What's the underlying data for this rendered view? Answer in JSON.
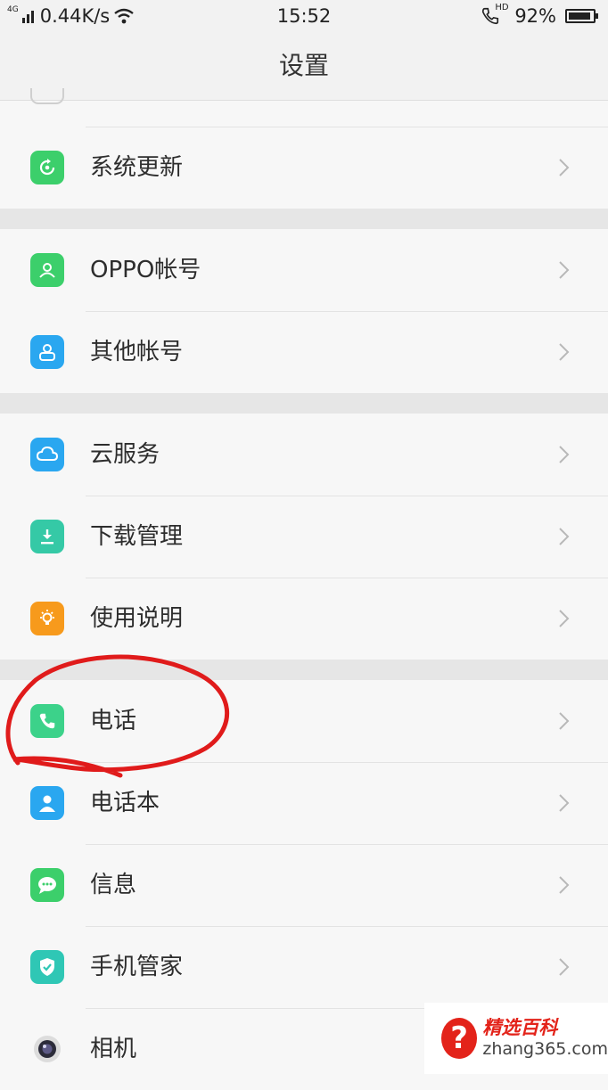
{
  "status_bar": {
    "network": "4G",
    "speed": "0.44K/s",
    "time": "15:52",
    "call_icon_label": "HD",
    "battery": "92%",
    "battery_level": 0.92
  },
  "header": {
    "title": "设置"
  },
  "groups": [
    {
      "items": [
        {
          "label": "系统更新",
          "icon": "system-update-icon",
          "color": "#3ccf6b"
        }
      ]
    },
    {
      "items": [
        {
          "label": "OPPO帐号",
          "icon": "oppo-account-icon",
          "color": "#3ccf6b"
        },
        {
          "label": "其他帐号",
          "icon": "other-account-icon",
          "color": "#2aa7f0"
        }
      ]
    },
    {
      "items": [
        {
          "label": "云服务",
          "icon": "cloud-icon",
          "color": "#2aa7f0"
        },
        {
          "label": "下载管理",
          "icon": "download-icon",
          "color": "#35c9a6"
        },
        {
          "label": "使用说明",
          "icon": "bulb-icon",
          "color": "#f79a1c"
        }
      ]
    },
    {
      "items": [
        {
          "label": "电话",
          "icon": "phone-icon",
          "color": "#3cd28a"
        },
        {
          "label": "电话本",
          "icon": "contacts-icon",
          "color": "#2aa7f0"
        },
        {
          "label": "信息",
          "icon": "message-icon",
          "color": "#3ccf6b"
        },
        {
          "label": "手机管家",
          "icon": "phone-manager-icon",
          "color": "#2fc7b5"
        },
        {
          "label": "相机",
          "icon": "camera-icon",
          "color": "#8a8a8a"
        }
      ]
    }
  ],
  "annotation_color": "#e01b1b",
  "watermark": {
    "brand": "精选百科",
    "url": "zhang365.com",
    "accent": "#e3231a"
  }
}
